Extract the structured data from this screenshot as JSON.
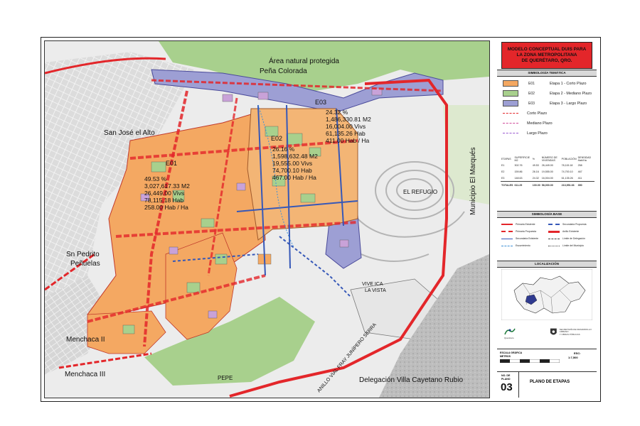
{
  "title_block": {
    "title_lines": [
      "MODELO CONCEPTUAL DUIS PARA",
      "LA ZONA METROPOLITANA",
      "DE QUERÉTARO, QRO."
    ]
  },
  "legend_tematica": {
    "heading": "SIMBOLOGÍA TEMÁTICA",
    "stages": [
      {
        "code": "E01",
        "label": "Etapa 1 - Corto Plazo",
        "color": "#f4a862"
      },
      {
        "code": "E02",
        "label": "Etapa 2 - Mediano Plazo",
        "color": "#a8d08d"
      },
      {
        "code": "E03",
        "label": "Etapa 3 - Largo Plazo",
        "color": "#9d9fd4"
      }
    ],
    "lines": [
      {
        "label": "Corto Plazo",
        "color": "#e3262a"
      },
      {
        "label": "Mediano Plazo",
        "color": "#d04c9a"
      },
      {
        "label": "Largo Plazo",
        "color": "#9b5ad0"
      }
    ]
  },
  "stages_table": {
    "headers": [
      "ETAPAS",
      "SUPERFICIE M2",
      "%",
      "NÚMERO DE VIVIENDAS",
      "POBLACIÓN",
      "DENSIDAD Hab/Ha"
    ],
    "rows": [
      [
        "E1",
        "302.76",
        "49.53",
        "26,449.00",
        "78,115.18",
        "258"
      ],
      [
        "E2",
        "159.86",
        "26.16",
        "19,555.00",
        "74,700.10",
        "467"
      ],
      [
        "E3",
        "148.63",
        "24.32",
        "16,004.00",
        "61,135.26",
        "411"
      ]
    ],
    "totals": [
      "TOTALES",
      "611.25",
      "100.00",
      "58,000.00",
      "213,951.66",
      "350"
    ]
  },
  "legend_base": {
    "heading": "SIMBOLOGÍA BASE",
    "items": [
      {
        "label": "Primaria Existente",
        "color": "#e3262a"
      },
      {
        "label": "Secundaria Propuesta",
        "color": "#3658b8"
      },
      {
        "label": "Primaria Propuesta",
        "color": "#e3262a"
      },
      {
        "label": "Anillo Existente",
        "color": "#e3262a"
      },
      {
        "label": "Secundaria Existente",
        "color": "#3658b8"
      },
      {
        "label": "Límite de Delegación",
        "color": "#444444"
      },
      {
        "label": "Escurrimiento",
        "color": "#3e8fd6"
      },
      {
        "label": "Límite del Municipio",
        "color": "#444444"
      }
    ]
  },
  "localization": {
    "heading": "LOCALIZACIÓN"
  },
  "logos": {
    "left": "Querétaro",
    "right_lines": [
      "SECRETARÍA DE DESARROLLO URBANO",
      "Y OBRAS PÚBLICAS"
    ]
  },
  "scale": {
    "label_lines": [
      "ESCALA GRÁFICA",
      "METROS"
    ],
    "esc_label": "ESC:",
    "esc_value": "1:7,500"
  },
  "plano": {
    "no_label_lines": [
      "NO. DE",
      "PLANO"
    ],
    "number": "03",
    "name": "PLANO DE ETAPAS"
  },
  "map": {
    "place_labels": {
      "area_natural": "Área natural protegida",
      "pena_colorada": "Peña Colorada",
      "san_jose": "San José el Alto",
      "sn_pedrito": "Sn Pedrito",
      "penuelas": "Peñuelas",
      "menchaca_ii": "Menchaca II",
      "menchaca_iii": "Menchaca III",
      "el_refugio": "EL REFUGIO",
      "vive_ica": "VIVE ICA",
      "la_vista": "LA VISTA",
      "pepe": "PEPE",
      "municipio": "Municipio El Marqués",
      "delegacion": "Delegación Villa Cayetano Rubio",
      "anillo": "ANILLO VIAL FRAY JUNÍPERO SERRA"
    },
    "stage_stats": {
      "e01": {
        "code": "E01",
        "lines": [
          "49.53 %",
          "3,027,617.33 M2",
          "26,449.00 Vivs",
          "78,115.18 Hab",
          "258.00 Hab / Ha"
        ]
      },
      "e02": {
        "code": "E02",
        "lines": [
          "26.16 %",
          "1,598,632.48 M2",
          "19,555.00 Vivs",
          "74,700.10 Hab",
          "467.00 Hab / Ha"
        ]
      },
      "e03": {
        "code": "E03",
        "lines": [
          "24.32 %",
          "1,486,330.81 M2",
          "16,004.00 Vivs",
          "61,135.26 Hab",
          "411.00 Hab / Ha"
        ]
      }
    }
  }
}
